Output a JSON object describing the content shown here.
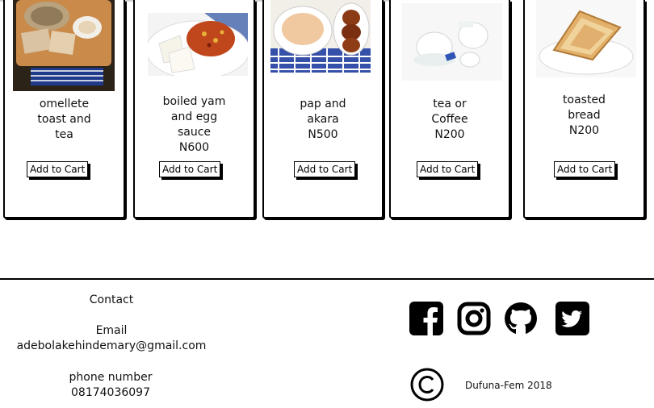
{
  "products": [
    {
      "name_lines": [
        "omellete",
        "toast and",
        "tea"
      ],
      "price": "",
      "button": "Add to Cart"
    },
    {
      "name_lines": [
        "boiled yam",
        "and egg",
        "sauce"
      ],
      "price": "N600",
      "button": "Add to Cart"
    },
    {
      "name_lines": [
        "pap and",
        "akara"
      ],
      "price": "N500",
      "button": "Add to Cart"
    },
    {
      "name_lines": [
        "tea or",
        "Coffee"
      ],
      "price": "N200",
      "button": "Add to Cart"
    },
    {
      "name_lines": [
        "toasted",
        "bread"
      ],
      "price": "N200",
      "button": "Add to Cart"
    }
  ],
  "footer": {
    "contact_label": "Contact",
    "email_label": "Email",
    "email_value": "adebolakehindemary@gmail.com",
    "phone_label": "phone number",
    "phone_value": "08174036097",
    "social_icons": [
      "facebook-icon",
      "instagram-icon",
      "github-icon",
      "twitter-icon"
    ],
    "copyright_symbol": "©",
    "copyright_text": "Dufuna-Fem 2018"
  }
}
